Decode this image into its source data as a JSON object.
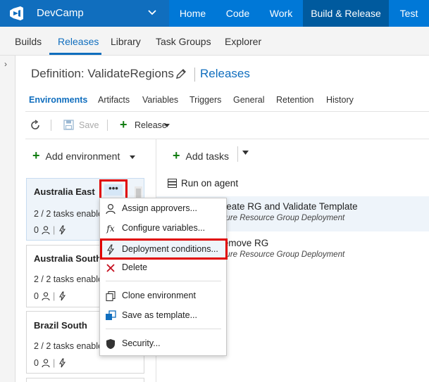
{
  "header": {
    "project": "DevCamp",
    "nav": [
      "Home",
      "Code",
      "Work",
      "Build & Release",
      "Test"
    ]
  },
  "subnav": [
    "Builds",
    "Releases",
    "Library",
    "Task Groups",
    "Explorer"
  ],
  "definition": {
    "title": "Definition: ValidateRegions",
    "breadcrumb": "Releases"
  },
  "tabs": [
    "Environments",
    "Artifacts",
    "Variables",
    "Triggers",
    "General",
    "Retention",
    "History"
  ],
  "toolbar": {
    "save": "Save",
    "release": "Release"
  },
  "environments": {
    "add_label": "Add environment",
    "more_label": "•••",
    "items": [
      {
        "name": "Australia East",
        "tasks": "2 / 2 tasks enabled",
        "approvers": "0"
      },
      {
        "name": "Australia Southeast",
        "tasks": "2 / 2 tasks enabled",
        "approvers": "0"
      },
      {
        "name": "Brazil South",
        "tasks": "2 / 2 tasks enabled",
        "approvers": "0"
      }
    ]
  },
  "tasks_panel": {
    "add_label": "Add tasks",
    "agent": "Run on agent",
    "tasks": [
      {
        "name": "Create RG and Validate Template",
        "type": "Azure Resource Group Deployment"
      },
      {
        "name": "Remove RG",
        "type": "Azure Resource Group Deployment"
      }
    ]
  },
  "context_menu": {
    "items": [
      {
        "label": "Assign approvers...",
        "icon": "person-icon"
      },
      {
        "label": "Configure variables...",
        "icon": "fx-icon"
      },
      {
        "label": "Deployment conditions...",
        "icon": "lightning-icon"
      },
      {
        "label": "Delete",
        "icon": "delete-x-icon"
      },
      {
        "label": "Clone environment",
        "icon": "clone-icon"
      },
      {
        "label": "Save as template...",
        "icon": "save-template-icon"
      },
      {
        "label": "Security...",
        "icon": "shield-icon"
      }
    ]
  },
  "colors": {
    "brand": "#0078d7",
    "brand_dark": "#005a9e",
    "highlight": "#e00000",
    "add_green": "#107c10"
  }
}
